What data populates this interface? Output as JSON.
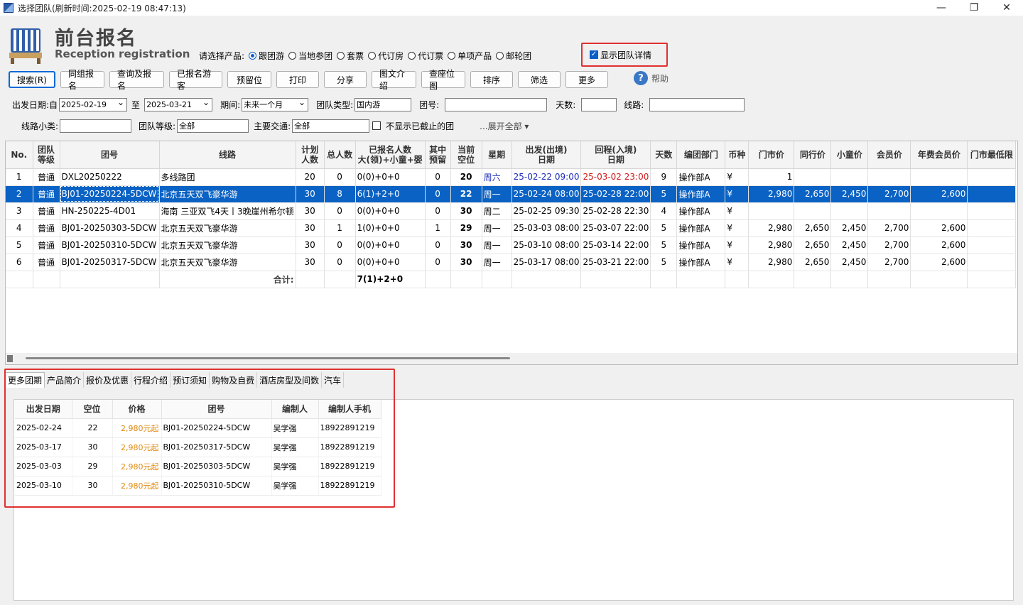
{
  "window": {
    "title": "选择团队(刷新时间:2025-02-19   08:47:13)",
    "min": "—",
    "max": "❐",
    "close": "✕"
  },
  "brand": {
    "cn": "前台报名",
    "en": "Reception registration"
  },
  "product": {
    "label": "请选择产品:",
    "options": [
      {
        "label": "跟团游",
        "checked": true
      },
      {
        "label": "当地参团",
        "checked": false
      },
      {
        "label": "套票",
        "checked": false
      },
      {
        "label": "代订房",
        "checked": false
      },
      {
        "label": "代订票",
        "checked": false
      },
      {
        "label": "单项产品",
        "checked": false
      },
      {
        "label": "邮轮团",
        "checked": false
      }
    ]
  },
  "show_detail": {
    "label": "显示团队详情",
    "checked": true
  },
  "toolbar": {
    "buttons": [
      "搜索(R)",
      "同组报名",
      "查询及报名",
      "已报名游客",
      "预留位",
      "打印",
      "分享",
      "图文介绍",
      "查座位图",
      "排序",
      "筛选",
      "更多"
    ],
    "help": "帮助"
  },
  "filters": {
    "depart_label": "出发日期:自",
    "date_from": "2025-02-19",
    "to_label": "至",
    "date_to": "2025-03-21",
    "period_label": "期间:",
    "period": "未来一个月",
    "type_label": "团队类型:",
    "type": "国内游",
    "teamno_label": "团号:",
    "teamno": "",
    "days_label": "天数:",
    "days": "",
    "route_label": "线路:",
    "route": "",
    "subtype_label": "线路小类:",
    "subtype": "",
    "level_label": "团队等级:",
    "level": "全部",
    "transport_label": "主要交通:",
    "transport": "全部",
    "hide_closed_label": "不显示已截止的团",
    "expand_label": "...展开全部 ▾"
  },
  "grid": {
    "headers": [
      "No.",
      "团队\n等级",
      "团号",
      "线路",
      "计划\n人数",
      "总人数",
      "已报名人数\n大(领)+小童+婴",
      "其中\n预留",
      "当前\n空位",
      "星期",
      "出发(出境)\n日期",
      "回程(入境)\n日期",
      "天数",
      "编团部门",
      "币种",
      "门市价",
      "同行价",
      "小童价",
      "会员价",
      "年费会员价",
      "门市最低限"
    ],
    "rows": [
      [
        "1",
        "普通",
        "DXL20250222",
        "多线路团",
        "20",
        "0",
        "0(0)+0+0",
        "0",
        "20",
        "周六",
        "25-02-22 09:00",
        "25-03-02 23:00",
        "9",
        "操作部A",
        "¥",
        "1",
        "",
        "",
        "",
        "",
        ""
      ],
      [
        "2",
        "普通",
        "BJ01-20250224-5DCW",
        "北京五天双飞豪华游",
        "30",
        "8",
        "6(1)+2+0",
        "0",
        "22",
        "周一",
        "25-02-24 08:00",
        "25-02-28 22:00",
        "5",
        "操作部A",
        "¥",
        "2,980",
        "2,650",
        "2,450",
        "2,700",
        "2,600",
        ""
      ],
      [
        "3",
        "普通",
        "HN-250225-4D01",
        "海南 三亚双飞4天丨3晚崖州希尔顿",
        "30",
        "0",
        "0(0)+0+0",
        "0",
        "30",
        "周二",
        "25-02-25 09:30",
        "25-02-28 22:30",
        "4",
        "操作部A",
        "¥",
        "",
        "",
        "",
        "",
        "",
        ""
      ],
      [
        "4",
        "普通",
        "BJ01-20250303-5DCW",
        "北京五天双飞豪华游",
        "30",
        "1",
        "1(0)+0+0",
        "1",
        "29",
        "周一",
        "25-03-03 08:00",
        "25-03-07 22:00",
        "5",
        "操作部A",
        "¥",
        "2,980",
        "2,650",
        "2,450",
        "2,700",
        "2,600",
        ""
      ],
      [
        "5",
        "普通",
        "BJ01-20250310-5DCW",
        "北京五天双飞豪华游",
        "30",
        "0",
        "0(0)+0+0",
        "0",
        "30",
        "周一",
        "25-03-10 08:00",
        "25-03-14 22:00",
        "5",
        "操作部A",
        "¥",
        "2,980",
        "2,650",
        "2,450",
        "2,700",
        "2,600",
        ""
      ],
      [
        "6",
        "普通",
        "BJ01-20250317-5DCW",
        "北京五天双飞豪华游",
        "30",
        "0",
        "0(0)+0+0",
        "0",
        "30",
        "周一",
        "25-03-17 08:00",
        "25-03-21 22:00",
        "5",
        "操作部A",
        "¥",
        "2,980",
        "2,650",
        "2,450",
        "2,700",
        "2,600",
        ""
      ]
    ],
    "selected_row": 1,
    "total_label": "合计:",
    "total_value": "7(1)+2+0"
  },
  "lower": {
    "tabs": [
      "更多团期",
      "产品简介",
      "报价及优惠",
      "行程介绍",
      "预订须知",
      "购物及自费",
      "酒店房型及间数",
      "汽车"
    ],
    "active_tab": 0,
    "headers": [
      "出发日期",
      "空位",
      "价格",
      "团号",
      "编制人",
      "编制人手机"
    ],
    "rows": [
      [
        "2025-02-24",
        "22",
        "2,980元起",
        "BJ01-20250224-5DCW",
        "吴学强",
        "18922891219"
      ],
      [
        "2025-03-17",
        "30",
        "2,980元起",
        "BJ01-20250317-5DCW",
        "吴学强",
        "18922891219"
      ],
      [
        "2025-03-03",
        "29",
        "2,980元起",
        "BJ01-20250303-5DCW",
        "吴学强",
        "18922891219"
      ],
      [
        "2025-03-10",
        "30",
        "2,980元起",
        "BJ01-20250310-5DCW",
        "吴学强",
        "18922891219"
      ]
    ]
  },
  "colors": {
    "accent": "#0a62c4",
    "highlight_box": "#e03030",
    "price": "#e08a12"
  }
}
